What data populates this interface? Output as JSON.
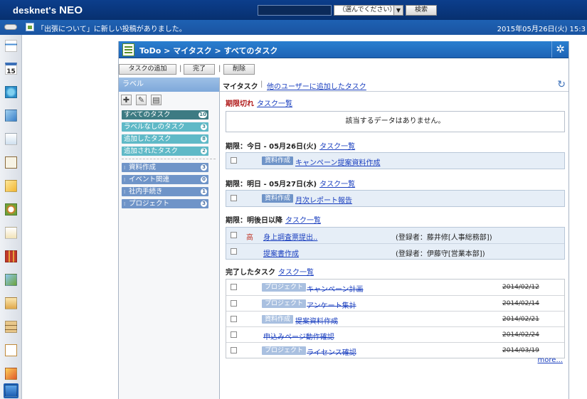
{
  "app": {
    "logo_left": "desknet's",
    "logo_right": "NEO"
  },
  "search": {
    "select_label": "（選んでください）",
    "button_label": "検索"
  },
  "notice": {
    "text": "「出張について」に新しい投稿がありました。",
    "datetime": "2015年05月26日(火) 15:3"
  },
  "dock": {
    "items": [
      "portal-icon",
      "calendar-icon",
      "mail-icon",
      "message-icon",
      "workflow-icon",
      "clipboard-icon",
      "memo-icon",
      "sync-icon",
      "form-icon",
      "book-icon",
      "address-book-icon",
      "contact-icon",
      "cabinet-icon",
      "notebook-icon",
      "warning-icon",
      "neo-icon"
    ],
    "calendar_day": "15"
  },
  "header": {
    "title": "ToDo > マイタスク > すべてのタスク"
  },
  "toolbar": {
    "add_label": "タスクの追加",
    "sep": "|",
    "done_label": "完了",
    "delete_label": "削除"
  },
  "labels": {
    "title": "ラベル",
    "system": [
      {
        "name": "すべてのタスク",
        "count": "10"
      },
      {
        "name": "ラベルなしのタスク",
        "count": "3"
      },
      {
        "name": "追加したタスク",
        "count": "8"
      },
      {
        "name": "追加されたタスク",
        "count": "2"
      }
    ],
    "custom": [
      {
        "name": "資料作成",
        "count": "3"
      },
      {
        "name": "イベント関連",
        "count": "0"
      },
      {
        "name": "社内手続き",
        "count": "1"
      },
      {
        "name": "プロジェクト",
        "count": "3"
      }
    ]
  },
  "tabs": {
    "active": "マイタスク",
    "separator": "|",
    "other": "他のユーザーに追加したタスク"
  },
  "sections": {
    "overdue": {
      "title": "期限切れ",
      "link": "タスク一覧",
      "empty": "該当するデータはありません。"
    },
    "today": {
      "title": "期限：今日 - 05月26日(火)",
      "link": "タスク一覧"
    },
    "tomorrow": {
      "title": "期限：明日 - 05月27日(水)",
      "link": "タスク一覧"
    },
    "later": {
      "title": "期限：明後日以降",
      "link": "タスク一覧"
    },
    "done": {
      "title": "完了したタスク",
      "link": "タスク一覧"
    }
  },
  "tasks": {
    "today": [
      {
        "label": "資料作成",
        "name": "キャンペーン提案資料作成"
      }
    ],
    "tomorrow": [
      {
        "label": "資料作成",
        "name": "月次レポート報告"
      }
    ],
    "later": [
      {
        "priority": "高",
        "name": "身上調査票提出..",
        "registrant": "(登録者：藤井修[人事総務部])"
      },
      {
        "priority": "",
        "name": "提案書作成",
        "registrant": "(登録者：伊藤守[営業本部])"
      }
    ],
    "done": [
      {
        "label": "プロジェクト",
        "name": "キャンペーン計画",
        "date": "2014/02/12"
      },
      {
        "label": "プロジェクト",
        "name": "アンケート集計",
        "date": "2014/02/14"
      },
      {
        "label": "資料作成",
        "name": "提案資料作成",
        "date": "2014/02/21"
      },
      {
        "label": "",
        "name": "申込みページ動作確認",
        "date": "2014/02/24"
      },
      {
        "label": "プロジェクト",
        "name": "ライセンス確認",
        "date": "2014/03/19"
      }
    ]
  },
  "more_link": "more..."
}
